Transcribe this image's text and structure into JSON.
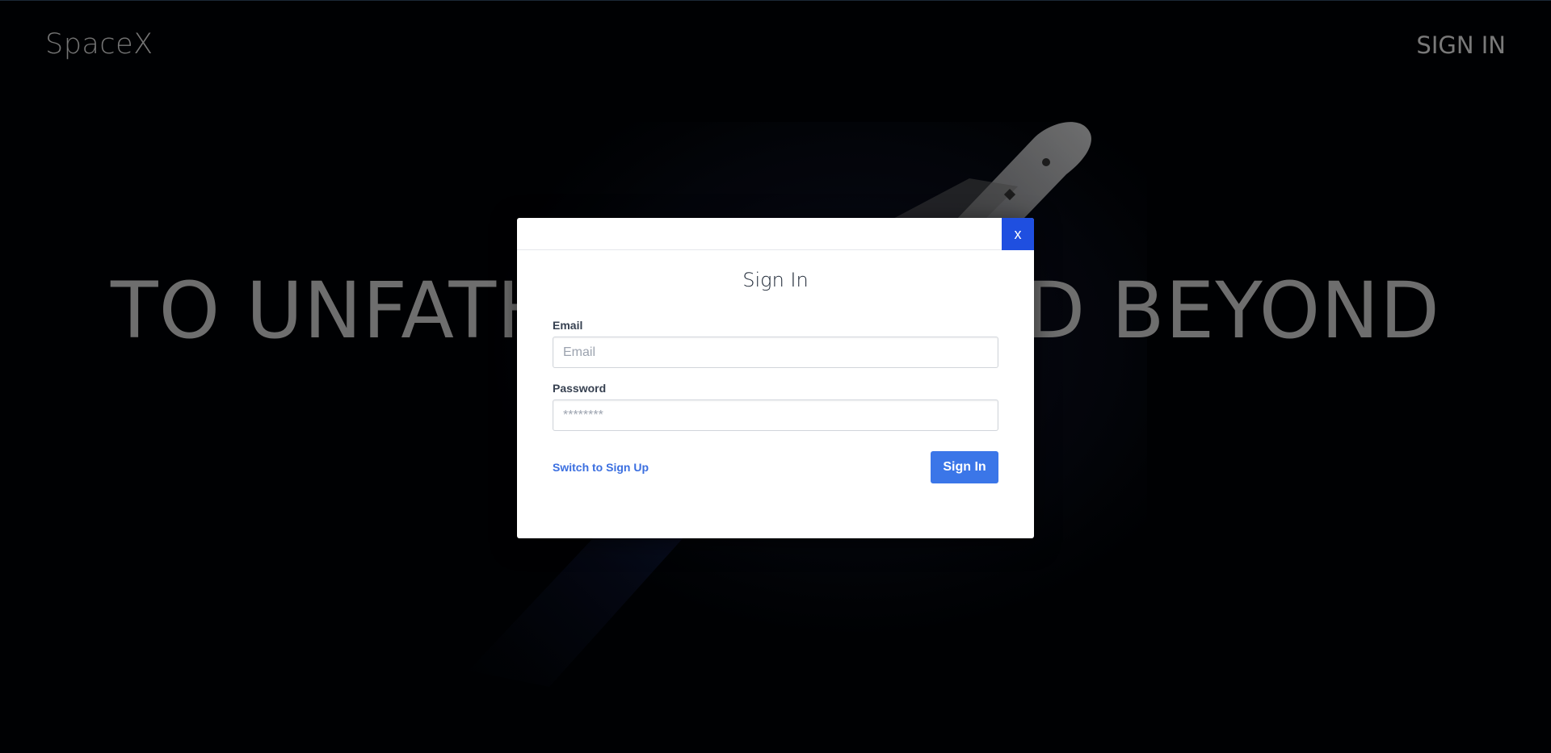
{
  "header": {
    "brand": "SpaceX",
    "sign_in_link": "SIGN IN"
  },
  "hero": {
    "headline": "TO UNFATHOMABLE AND BEYOND"
  },
  "modal": {
    "close_label": "x",
    "title": "Sign In",
    "email": {
      "label": "Email",
      "placeholder": "Email",
      "value": ""
    },
    "password": {
      "label": "Password",
      "placeholder": "********",
      "value": ""
    },
    "switch_link": "Switch to Sign Up",
    "submit_label": "Sign In"
  },
  "colors": {
    "close_button": "#1f4fe0",
    "submit_button": "#3b76e8",
    "link": "#3b6fe0"
  }
}
